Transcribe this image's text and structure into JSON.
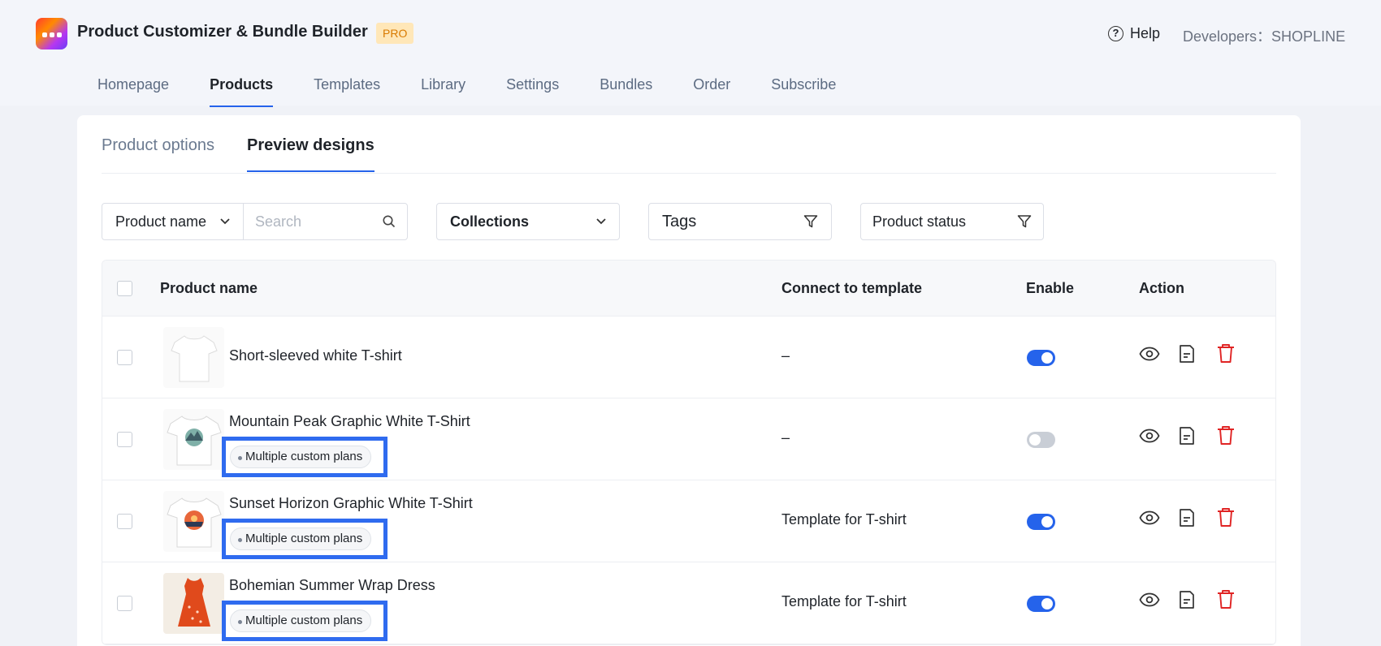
{
  "app": {
    "title": "Product Customizer & Bundle Builder",
    "badge": "PRO",
    "help": "Help",
    "developer_label": "Developers：",
    "developer_value": "SHOPLINE"
  },
  "nav": [
    "Homepage",
    "Products",
    "Templates",
    "Library",
    "Settings",
    "Bundles",
    "Order",
    "Subscribe"
  ],
  "nav_active": "Products",
  "subtabs": [
    "Product options",
    "Preview designs"
  ],
  "subtab_active": "Preview designs",
  "filters": {
    "product_name_select": "Product name",
    "search_placeholder": "Search",
    "collections": "Collections",
    "tags": "Tags",
    "product_status": "Product status"
  },
  "table": {
    "headers": {
      "name": "Product name",
      "template": "Connect to template",
      "enable": "Enable",
      "action": "Action"
    },
    "rows": [
      {
        "name": "Short-sleeved white T-shirt",
        "template": "–",
        "enabled": true,
        "badge": ""
      },
      {
        "name": "Mountain Peak Graphic White T-Shirt",
        "template": "–",
        "enabled": false,
        "badge": "Multiple custom plans"
      },
      {
        "name": "Sunset Horizon Graphic White T-Shirt",
        "template": "Template for T-shirt",
        "enabled": true,
        "badge": "Multiple custom plans"
      },
      {
        "name": "Bohemian Summer Wrap Dress",
        "template": "Template for T-shirt",
        "enabled": true,
        "badge": "Multiple custom plans"
      }
    ]
  },
  "colors": {
    "accent": "#2563eb",
    "highlight": "#2f6bef",
    "delete": "#e02424",
    "pro_bg": "#ffe7b8"
  }
}
